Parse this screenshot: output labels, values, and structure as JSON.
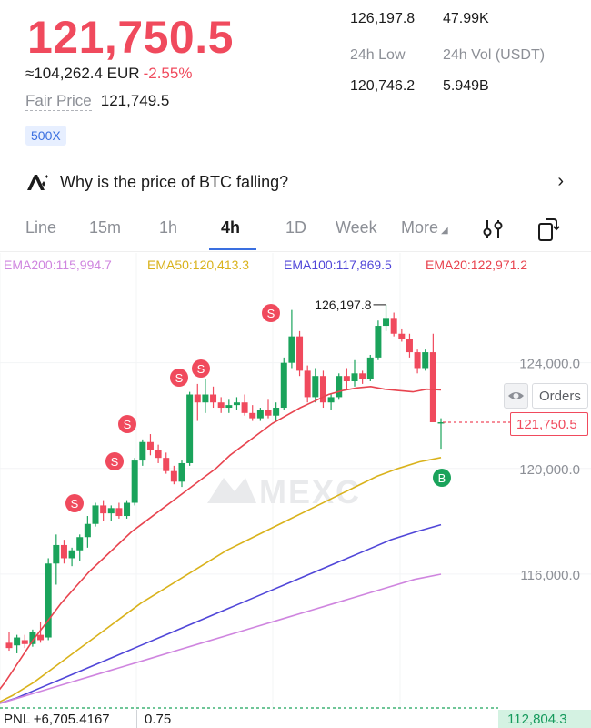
{
  "header": {
    "last_price": "121,750.5",
    "fx_value": "≈104,262.4 EUR",
    "change_pct": "-2.55%",
    "fair_price_label": "Fair Price",
    "fair_price_value": "121,749.5",
    "leverage_badge": "500X"
  },
  "stats": {
    "high_value": "126,197.8",
    "vol_btc_value": "47.99K",
    "low_label": "24h Low",
    "vol_usdt_label": "24h Vol  (USDT)",
    "low_value": "120,746.2",
    "vol_usdt_value": "5.949B"
  },
  "ai_banner": {
    "text": "Why is the price of BTC falling?",
    "icon": "ai-sparkle-icon"
  },
  "tabs": {
    "line": "Line",
    "m15": "15m",
    "h1": "1h",
    "h4": "4h",
    "d1": "1D",
    "week": "Week",
    "more": "More",
    "active": "4h"
  },
  "indicators": {
    "ema200": "EMA200:115,994.7",
    "ema50": "EMA50:120,413.3",
    "ema100": "EMA100:117,869.5",
    "ema20": "EMA20:122,971.2"
  },
  "chart_overlays": {
    "high_marker": "126,197.8",
    "orders_label": "Orders",
    "last_price_tag": "121,750.5",
    "watermark": "MEXC",
    "y_ticks": [
      "124,000.0",
      "120,000.0",
      "116,000.0"
    ]
  },
  "chart_data": {
    "type": "candlestick",
    "ylim": [
      111000,
      127400
    ],
    "y_ticks": [
      124000,
      120000,
      116000
    ],
    "candles": [
      {
        "o": 113400,
        "h": 113800,
        "l": 113100,
        "c": 113200
      },
      {
        "o": 113300,
        "h": 113700,
        "l": 113000,
        "c": 113600
      },
      {
        "o": 113500,
        "h": 113700,
        "l": 113200,
        "c": 113350
      },
      {
        "o": 113350,
        "h": 113900,
        "l": 113250,
        "c": 113800
      },
      {
        "o": 113700,
        "h": 114200,
        "l": 113400,
        "c": 113500
      },
      {
        "o": 113600,
        "h": 116600,
        "l": 113500,
        "c": 116400
      },
      {
        "o": 116400,
        "h": 117500,
        "l": 115600,
        "c": 117100
      },
      {
        "o": 117100,
        "h": 117300,
        "l": 116400,
        "c": 116600
      },
      {
        "o": 116600,
        "h": 117000,
        "l": 116300,
        "c": 116900
      },
      {
        "o": 116900,
        "h": 117500,
        "l": 116500,
        "c": 117400
      },
      {
        "o": 117400,
        "h": 118200,
        "l": 117000,
        "c": 117900
      },
      {
        "o": 117900,
        "h": 118700,
        "l": 117800,
        "c": 118600
      },
      {
        "o": 118600,
        "h": 118800,
        "l": 118000,
        "c": 118300
      },
      {
        "o": 118300,
        "h": 118600,
        "l": 118000,
        "c": 118500
      },
      {
        "o": 118500,
        "h": 118700,
        "l": 118100,
        "c": 118200
      },
      {
        "o": 118200,
        "h": 118800,
        "l": 118100,
        "c": 118700
      },
      {
        "o": 118700,
        "h": 120400,
        "l": 118600,
        "c": 120300
      },
      {
        "o": 120300,
        "h": 121100,
        "l": 120100,
        "c": 121000
      },
      {
        "o": 121000,
        "h": 121300,
        "l": 120500,
        "c": 120700
      },
      {
        "o": 120700,
        "h": 120900,
        "l": 120200,
        "c": 120400
      },
      {
        "o": 120400,
        "h": 120600,
        "l": 119800,
        "c": 119900
      },
      {
        "o": 119900,
        "h": 120100,
        "l": 119400,
        "c": 119500
      },
      {
        "o": 119500,
        "h": 120300,
        "l": 119300,
        "c": 120200
      },
      {
        "o": 120200,
        "h": 122900,
        "l": 120100,
        "c": 122800
      },
      {
        "o": 122800,
        "h": 123200,
        "l": 121800,
        "c": 122500
      },
      {
        "o": 122500,
        "h": 123400,
        "l": 122100,
        "c": 122800
      },
      {
        "o": 122800,
        "h": 123100,
        "l": 122300,
        "c": 122500
      },
      {
        "o": 122500,
        "h": 122700,
        "l": 122100,
        "c": 122300
      },
      {
        "o": 122300,
        "h": 122600,
        "l": 122100,
        "c": 122400
      },
      {
        "o": 122400,
        "h": 122700,
        "l": 122200,
        "c": 122500
      },
      {
        "o": 122500,
        "h": 122800,
        "l": 122000,
        "c": 122100
      },
      {
        "o": 122100,
        "h": 122400,
        "l": 121800,
        "c": 121900
      },
      {
        "o": 121900,
        "h": 122300,
        "l": 121800,
        "c": 122200
      },
      {
        "o": 122200,
        "h": 122600,
        "l": 121900,
        "c": 122000
      },
      {
        "o": 122000,
        "h": 122500,
        "l": 121800,
        "c": 122300
      },
      {
        "o": 122300,
        "h": 124200,
        "l": 122200,
        "c": 124000
      },
      {
        "o": 124000,
        "h": 126000,
        "l": 123800,
        "c": 125000
      },
      {
        "o": 125000,
        "h": 125200,
        "l": 123500,
        "c": 123700
      },
      {
        "o": 123700,
        "h": 123900,
        "l": 122500,
        "c": 122700
      },
      {
        "o": 122700,
        "h": 123800,
        "l": 122500,
        "c": 123500
      },
      {
        "o": 123500,
        "h": 123700,
        "l": 122300,
        "c": 122500
      },
      {
        "o": 122500,
        "h": 122800,
        "l": 122200,
        "c": 122700
      },
      {
        "o": 122700,
        "h": 123600,
        "l": 122600,
        "c": 123500
      },
      {
        "o": 123500,
        "h": 123800,
        "l": 123000,
        "c": 123300
      },
      {
        "o": 123300,
        "h": 124100,
        "l": 123100,
        "c": 123600
      },
      {
        "o": 123600,
        "h": 123700,
        "l": 123200,
        "c": 123400
      },
      {
        "o": 123400,
        "h": 124300,
        "l": 123300,
        "c": 124200
      },
      {
        "o": 124200,
        "h": 125600,
        "l": 124100,
        "c": 125400
      },
      {
        "o": 125400,
        "h": 126198,
        "l": 125200,
        "c": 125700
      },
      {
        "o": 125700,
        "h": 125900,
        "l": 125000,
        "c": 125100
      },
      {
        "o": 125100,
        "h": 125300,
        "l": 124800,
        "c": 124900
      },
      {
        "o": 124900,
        "h": 125100,
        "l": 124200,
        "c": 124400
      },
      {
        "o": 124400,
        "h": 124500,
        "l": 123600,
        "c": 123800
      },
      {
        "o": 123800,
        "h": 124500,
        "l": 123700,
        "c": 124400
      },
      {
        "o": 124400,
        "h": 125100,
        "l": 122800,
        "c": 121750
      },
      {
        "o": 121750,
        "h": 121900,
        "l": 120746,
        "c": 121750
      }
    ],
    "ema_lines": [
      {
        "name": "EMA20",
        "color": "#e8444f",
        "values": [
          111200,
          111900,
          112700,
          113500,
          114200,
          114900,
          115500,
          116100,
          116600,
          117100,
          117600,
          118000,
          118400,
          118800,
          119200,
          119600,
          120000,
          120500,
          120900,
          121300,
          121700,
          122000,
          122300,
          122550,
          122800,
          122950,
          123050,
          123100,
          123000,
          122950,
          122900,
          123000,
          122971
        ]
      },
      {
        "name": "EMA50",
        "color": "#d9b21b",
        "values": [
          111000,
          111400,
          111900,
          112500,
          113100,
          113700,
          114300,
          114900,
          115400,
          115900,
          116400,
          116900,
          117300,
          117700,
          118100,
          118500,
          118900,
          119300,
          119700,
          120000,
          120250,
          120413
        ]
      },
      {
        "name": "EMA100",
        "color": "#5046d8",
        "values": [
          111000,
          111300,
          111700,
          112100,
          112500,
          112900,
          113300,
          113700,
          114100,
          114500,
          114900,
          115300,
          115700,
          116100,
          116500,
          116900,
          117300,
          117600,
          117869
        ]
      },
      {
        "name": "EMA200",
        "color": "#cf85df",
        "values": [
          111000,
          111300,
          111600,
          111900,
          112200,
          112500,
          112800,
          113100,
          113400,
          113700,
          114000,
          114300,
          114600,
          114900,
          115200,
          115500,
          115800,
          115995
        ]
      }
    ]
  },
  "footer": {
    "pnl": "PNL +6,705.4167",
    "qty": "0.75",
    "liq_price": "112,804.3"
  },
  "colors": {
    "up": "#1aa35b",
    "down": "#f04a5d",
    "accent": "#3a6fe0"
  }
}
